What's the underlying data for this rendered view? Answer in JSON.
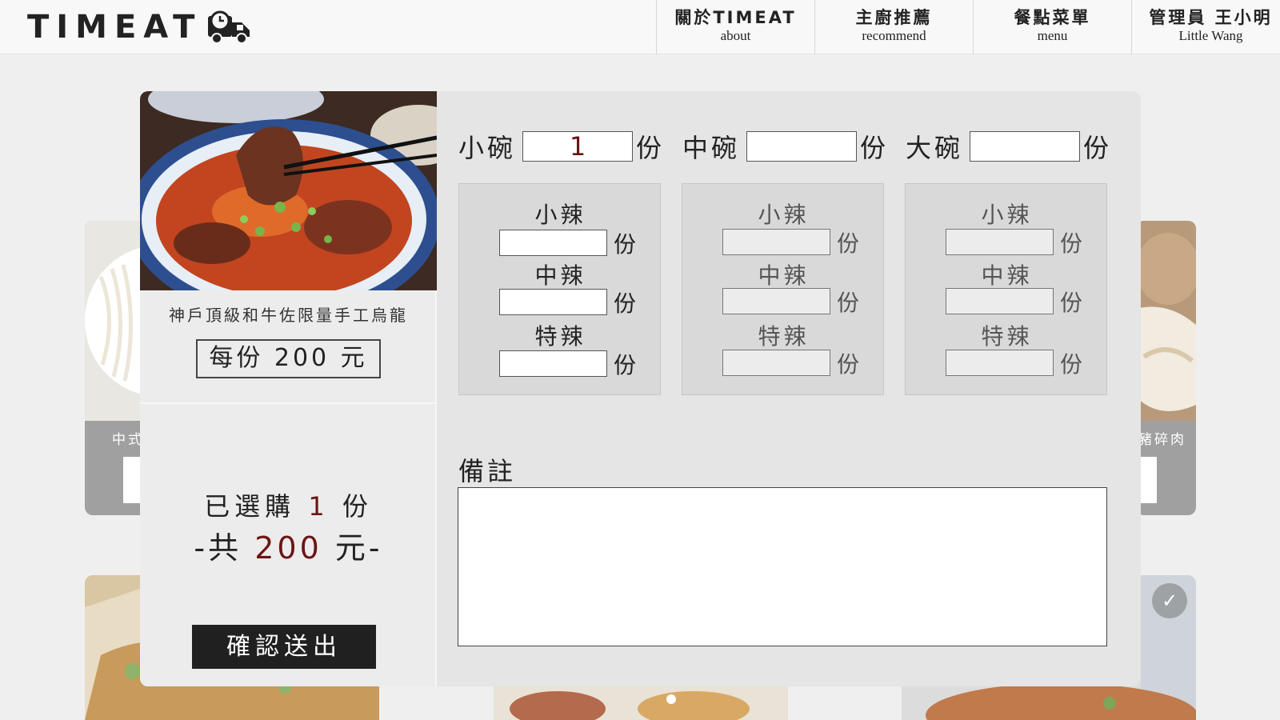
{
  "brand": {
    "logo_text": "TIMEAT",
    "logo_icon": "delivery-truck-clock-icon"
  },
  "nav": [
    {
      "zh": "關於TIMEAT",
      "en": "about"
    },
    {
      "zh": "主廚推薦",
      "en": "recommend"
    },
    {
      "zh": "餐點菜單",
      "en": "menu"
    },
    {
      "zh": "管理員 王小明",
      "en": "Little Wang"
    }
  ],
  "background_cards": {
    "left_caption": "中式",
    "right_caption": "豬碎肉",
    "check_icon": "check-circle-icon"
  },
  "dish": {
    "name": "神戶頂級和牛佐限量手工烏龍",
    "price_label": "每份 200 元"
  },
  "summary": {
    "prefix": "已選購",
    "count": "1",
    "count_unit": "份",
    "total_prefix": "-共",
    "total": "200",
    "total_unit": "元-"
  },
  "confirm_button": "確認送出",
  "bowls": [
    {
      "label": "小碗",
      "value": "1",
      "unit": "份"
    },
    {
      "label": "中碗",
      "value": "",
      "unit": "份"
    },
    {
      "label": "大碗",
      "value": "",
      "unit": "份"
    }
  ],
  "spice_levels": [
    "小辣",
    "中辣",
    "特辣"
  ],
  "spice_unit": "份",
  "notes": {
    "label": "備註",
    "value": ""
  },
  "colors": {
    "accent": "#6b1414",
    "modal_bg": "#e5e5e5",
    "button_bg": "#202020",
    "bg_card": "#a0a0a0"
  }
}
